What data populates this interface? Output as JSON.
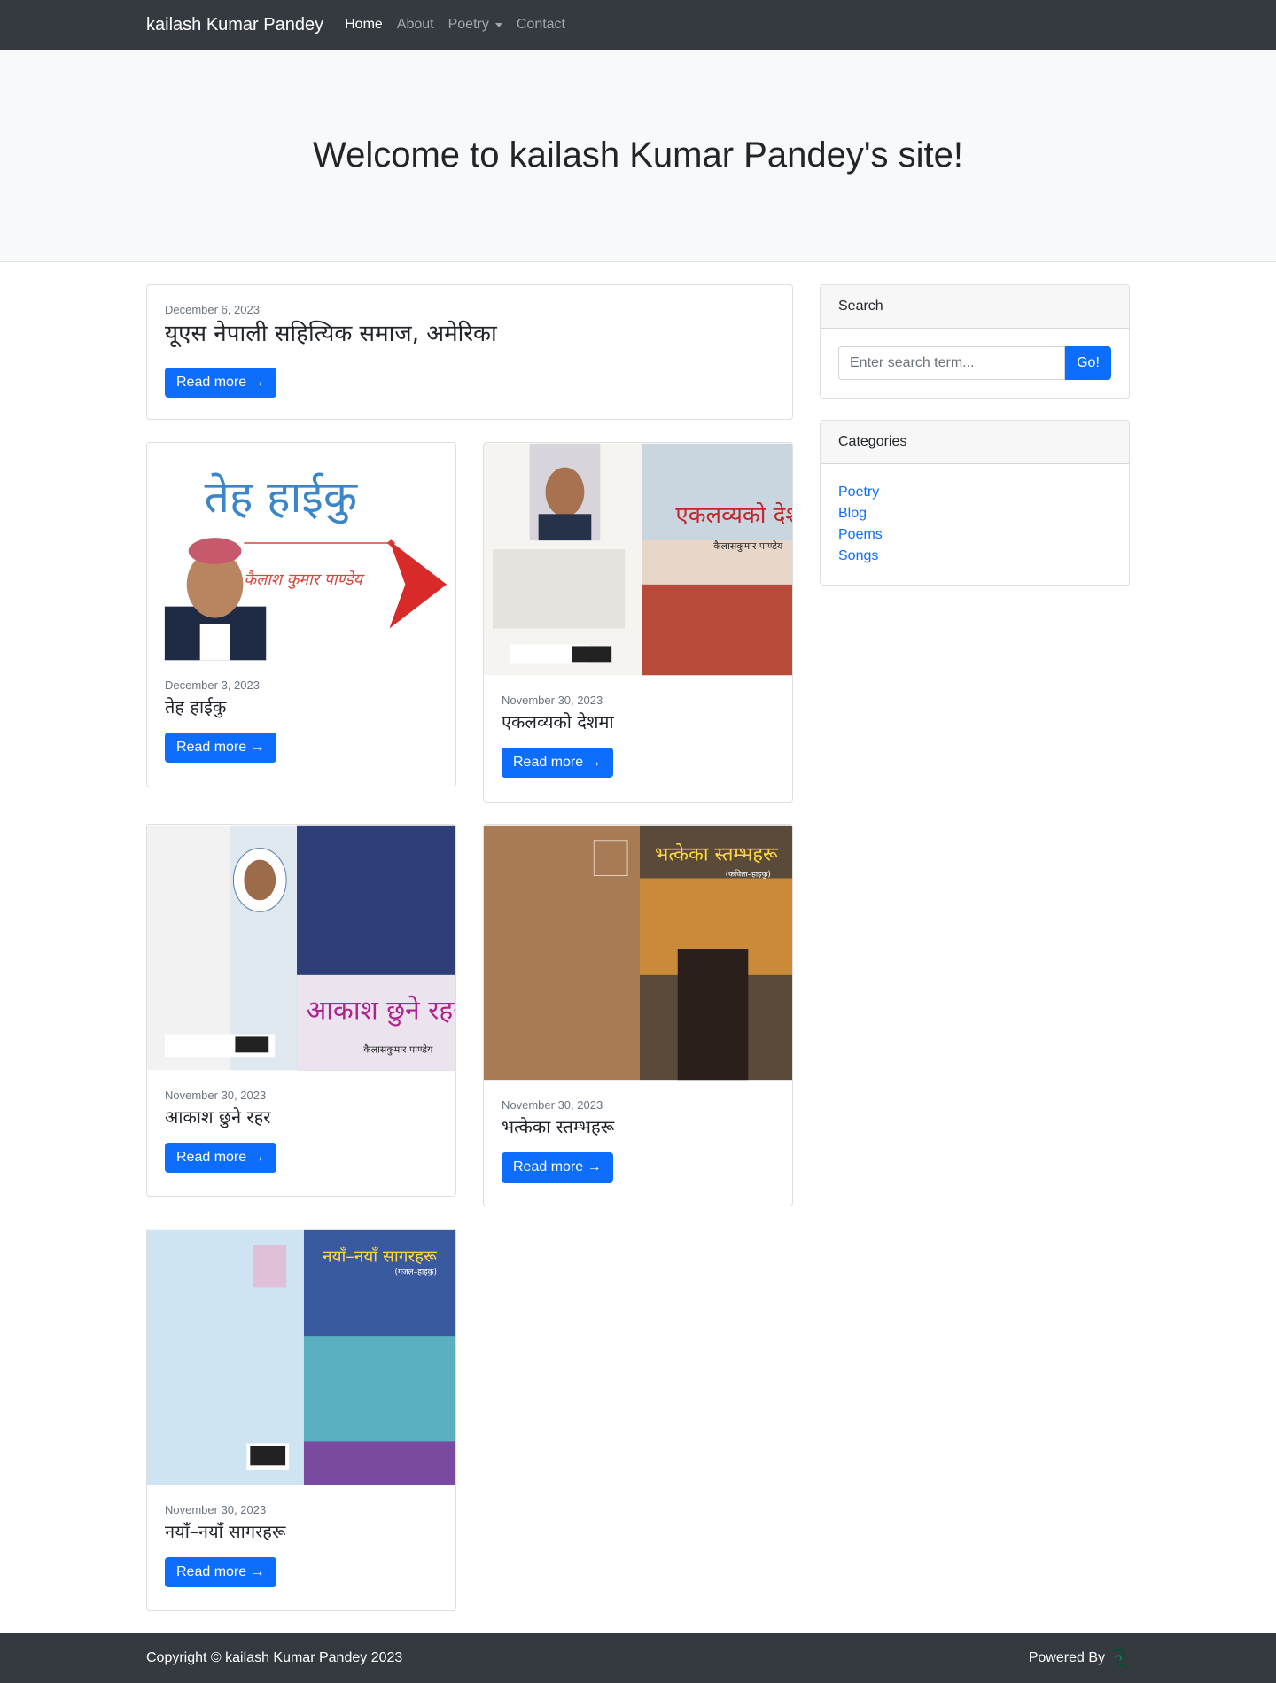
{
  "nav": {
    "brand": "kailash Kumar Pandey",
    "links": [
      "Home",
      "About",
      "Poetry",
      "Contact"
    ]
  },
  "hero": {
    "title": "Welcome to kailash Kumar Pandey's site!"
  },
  "featured": {
    "date": "December 6, 2023",
    "title": "यूएस नेपाली सहित्यिक समाज, अमेरिका",
    "button": "Read more →"
  },
  "posts": [
    {
      "date": "December 3, 2023",
      "title": "तेह हाईकु",
      "button": "Read more →",
      "cover_title": "तेह हाईकु",
      "cover_author": "कैलाश कुमार पाण्डेय"
    },
    {
      "date": "November 30, 2023",
      "title": "एकलव्यको देशमा",
      "button": "Read more →",
      "cover_title": "एकलव्यको देशमा",
      "cover_author": "कैलासकुमार पाण्डेय"
    },
    {
      "date": "November 30, 2023",
      "title": "आकाश छुने रहर",
      "button": "Read more →",
      "cover_title": "आकाश छुने रहर",
      "cover_author": "कैलासकुमार पाण्डेय"
    },
    {
      "date": "November 30, 2023",
      "title": "भत्केका स्तम्भहरू",
      "button": "Read more →",
      "cover_title": "भत्केका स्तम्भहरू",
      "cover_subtitle": "(कविता–हाइकु)"
    },
    {
      "date": "November 30, 2023",
      "title": "नयाँ–नयाँ सागरहरू",
      "button": "Read more →",
      "cover_title": "नयाँ–नयाँ सागरहरू",
      "cover_subtitle": "(गजल–हाइकु)"
    }
  ],
  "sidebar": {
    "search_title": "Search",
    "search_placeholder": "Enter search term...",
    "search_button": "Go!",
    "categories_title": "Categories",
    "categories": [
      "Poetry",
      "Blog",
      "Poems",
      "Songs"
    ]
  },
  "footer": {
    "copyright": "Copyright © kailash Kumar Pandey 2023",
    "powered": "Powered By"
  },
  "colors": {
    "navbar": "#343a40",
    "primary": "#0d6efd",
    "hero_bg": "#f8f9fa"
  }
}
